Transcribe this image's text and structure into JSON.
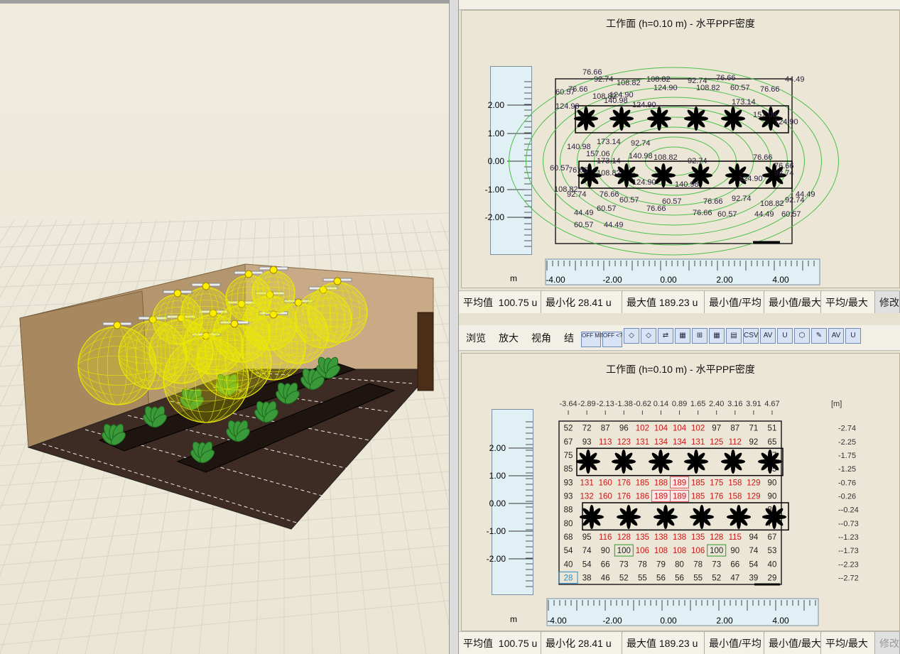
{
  "top_panel": {
    "title": "工作面 (h=0.10 m) - 水平PPF密度",
    "y_ticks": [
      "2.00",
      "1.00",
      "0.00",
      "-1.00",
      "-2.00"
    ],
    "x_ticks": [
      "-4.00",
      "-2.00",
      "0.00",
      "2.00",
      "4.00"
    ],
    "unit": "m",
    "contour_labels": [
      "76.66",
      "92.74",
      "108.82",
      "108.82",
      "92.74",
      "76.66",
      "44.49",
      "60.57",
      "76.66",
      "108.82",
      "124.90",
      "124.90",
      "108.82",
      "60.57",
      "76.66",
      "124.90",
      "140.98",
      "124.90",
      "173.14",
      "157.06",
      "124.90",
      "173.14",
      "92.74",
      "140.98",
      "157.06",
      "173.14",
      "140.98",
      "108.82",
      "92.74",
      "76.66",
      "76.66",
      "60.57",
      "76.66",
      "108.82",
      "124.90",
      "140.98",
      "124.90",
      "92.74",
      "108.82",
      "92.74",
      "76.66",
      "60.57",
      "60.57",
      "76.66",
      "92.74",
      "108.82",
      "92.74",
      "44.49",
      "44.49",
      "60.57",
      "76.66",
      "76.66",
      "60.57",
      "44.49",
      "60.57",
      "60.57",
      "44.49"
    ]
  },
  "status": {
    "avg_label": "平均值",
    "avg_value": "100.75",
    "unit_cut": "u",
    "min_label": "最小化",
    "min_value": "28.41",
    "max_label": "最大值",
    "max_value": "189.23",
    "ratio1": "最小值/平均",
    "ratio2": "最小值/最大",
    "ratio3": "平均/最大",
    "edit": "修改"
  },
  "toolbar": {
    "browse": "浏览",
    "zoom": "放大",
    "view": "视角",
    "more": "结",
    "icons": [
      "OFF MIN",
      "OFF <?",
      "◇",
      "◇",
      "⇄",
      "▦",
      "⊞",
      "▦",
      "▤",
      "CSV",
      "AV",
      "U",
      "⬡",
      "✎",
      "AV",
      "U"
    ]
  },
  "bottom_panel": {
    "title": "工作面 (h=0.10 m) - 水平PPF密度",
    "x_coords": [
      "-3.64",
      "-2.89",
      "-2.13",
      "-1.38",
      "-0.62",
      "0.14",
      "0.89",
      "1.65",
      "2.40",
      "3.16",
      "3.91",
      "4.67"
    ],
    "x_unit": "[m]",
    "y_coords": [
      "-2.74",
      "-2.25",
      "-1.75",
      "-1.25",
      "-0.76",
      "-0.26",
      "--0.24",
      "--0.73",
      "--1.23",
      "--1.73",
      "--2.23",
      "--2.72"
    ],
    "y_ticks": [
      "2.00",
      "1.00",
      "0.00",
      "-1.00",
      "-2.00"
    ],
    "x_ticks": [
      "-4.00",
      "-2.00",
      "0.00",
      "2.00",
      "4.00"
    ],
    "unit": "m",
    "grid": [
      [
        "52",
        "72",
        "87",
        "96",
        "102",
        "104",
        "104",
        "102",
        "97",
        "87",
        "71",
        "51"
      ],
      [
        "67",
        "93",
        "113",
        "123",
        "131",
        "134",
        "134",
        "131",
        "125",
        "112",
        "92",
        "65"
      ],
      [
        "75",
        "",
        "",
        "",
        "",
        "",
        "",
        "",
        "",
        "",
        "",
        "77"
      ],
      [
        "85",
        "",
        "",
        "",
        "",
        "",
        "",
        "",
        "",
        "",
        "",
        "85"
      ],
      [
        "93",
        "131",
        "160",
        "176",
        "185",
        "188",
        "189",
        "185",
        "175",
        "158",
        "129",
        "90"
      ],
      [
        "93",
        "132",
        "160",
        "176",
        "186",
        "189",
        "189",
        "185",
        "176",
        "158",
        "129",
        "90"
      ],
      [
        "88",
        "",
        "",
        "",
        "",
        "",
        "",
        "",
        "",
        "",
        "",
        "86"
      ],
      [
        "80",
        "",
        "",
        "",
        "",
        "",
        "",
        "",
        "",
        "",
        "",
        "78"
      ],
      [
        "68",
        "95",
        "116",
        "128",
        "135",
        "138",
        "138",
        "135",
        "128",
        "115",
        "94",
        "67"
      ],
      [
        "54",
        "74",
        "90",
        "100",
        "106",
        "108",
        "108",
        "106",
        "100",
        "90",
        "74",
        "53"
      ],
      [
        "40",
        "54",
        "66",
        "73",
        "78",
        "79",
        "80",
        "78",
        "73",
        "66",
        "54",
        "40"
      ],
      [
        "28",
        "38",
        "46",
        "52",
        "55",
        "56",
        "56",
        "55",
        "52",
        "47",
        "39",
        "29"
      ]
    ]
  },
  "colors": {
    "contour": "#4cc04c",
    "luminaire_sphere": "#e8e800",
    "floor": "#3b2a22",
    "wall": "#b0906a",
    "red_value": "#c81818",
    "max_box": "#e05050",
    "min_box": "#2a8fd0",
    "avg_box": "#2a9a2a"
  }
}
